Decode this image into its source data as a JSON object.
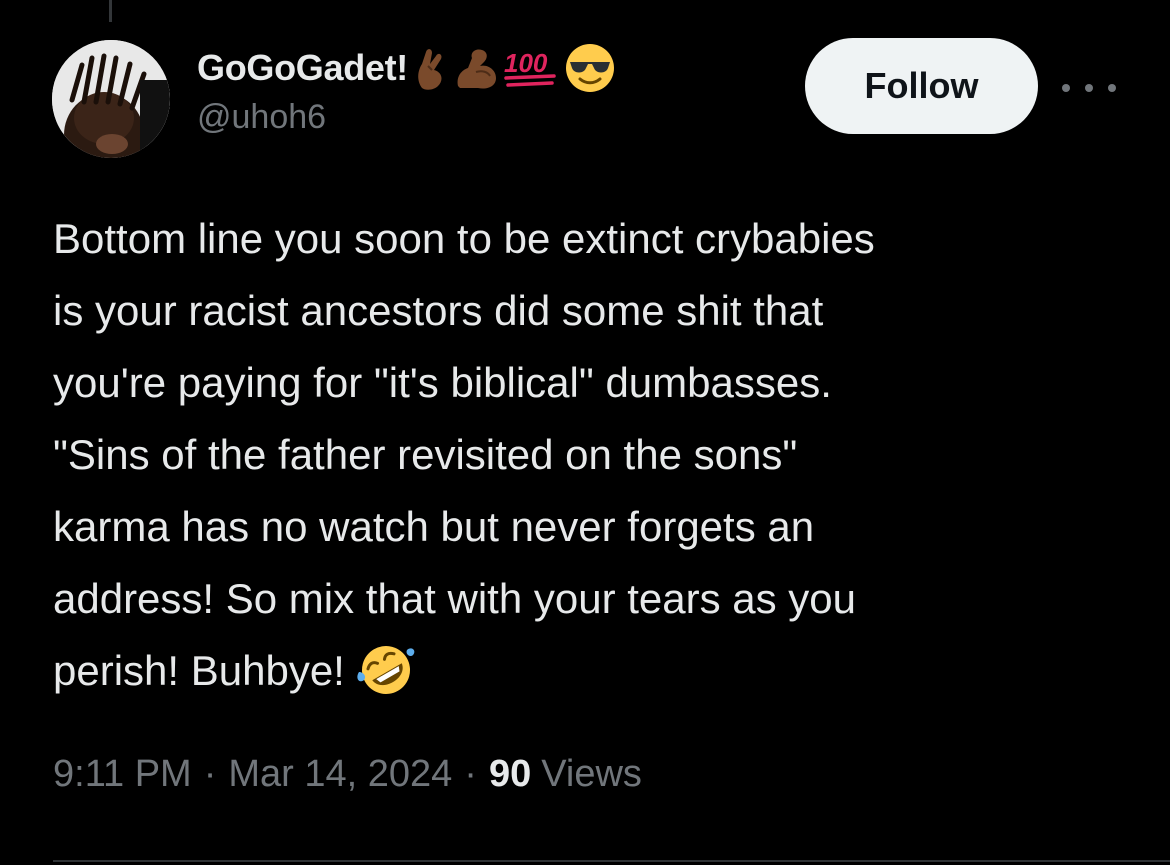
{
  "author": {
    "display_name": "GoGoGadet!",
    "name_emojis": [
      "pinching-hand-emoji",
      "flexed-biceps-emoji",
      "hundred-points-emoji",
      "sunglasses-face-emoji"
    ],
    "handle": "@uhoh6"
  },
  "actions": {
    "follow_label": "Follow",
    "more_icon": "more-horizontal-icon"
  },
  "tweet": {
    "lines": [
      "Bottom line you soon to be extinct crybabies",
      "is your racist ancestors did some shit that",
      "you're paying for \"it's biblical\" dumbasses.",
      "\"Sins of the father revisited on the sons\"",
      "karma has no watch but never forgets an",
      "address! So mix that with your tears as you",
      "perish! Buhbye!"
    ],
    "trailing_emoji": "rolling-on-floor-laughing-emoji"
  },
  "meta": {
    "time": "9:11 PM",
    "separator": "·",
    "date": "Mar 14, 2024",
    "views_count": "90",
    "views_label": "Views"
  },
  "colors": {
    "background": "#000000",
    "primary_text": "#e7e9ea",
    "secondary_text": "#71767b",
    "follow_button_bg": "#eff3f4",
    "follow_button_text": "#0f1419"
  }
}
